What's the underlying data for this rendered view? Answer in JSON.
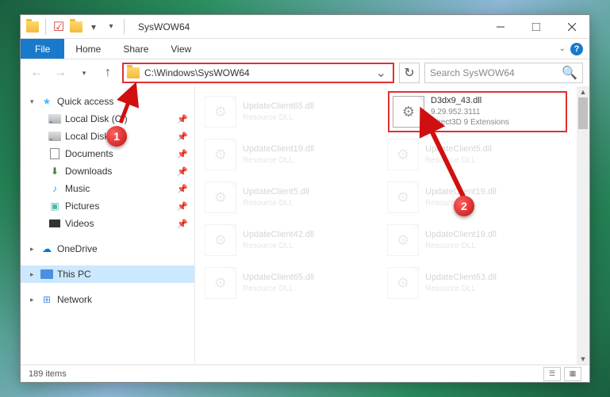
{
  "window": {
    "title": "SysWOW64"
  },
  "ribbon": {
    "file": "File",
    "tabs": [
      "Home",
      "Share",
      "View"
    ]
  },
  "nav": {
    "path": "C:\\Windows\\SysWOW64",
    "search_placeholder": "Search SysWOW64"
  },
  "sidebar": {
    "quick_access": "Quick access",
    "items": [
      {
        "label": "Local Disk (C:)",
        "icon": "disk"
      },
      {
        "label": "Local Disk (D:)",
        "icon": "disk"
      },
      {
        "label": "Documents",
        "icon": "doc"
      },
      {
        "label": "Downloads",
        "icon": "dl"
      },
      {
        "label": "Music",
        "icon": "music"
      },
      {
        "label": "Pictures",
        "icon": "pic"
      },
      {
        "label": "Videos",
        "icon": "vid"
      }
    ],
    "onedrive": "OneDrive",
    "thispc": "This PC",
    "network": "Network"
  },
  "highlight": {
    "name": "D3dx9_43.dll",
    "version": "9.29.952.3111",
    "desc": "Direct3D 9 Extensions"
  },
  "files": [
    {
      "name": "UpdateClient65.dll",
      "desc": "Resource DLL"
    },
    {
      "name": "UpdateClient19.dll",
      "desc": "Resource DLL"
    },
    {
      "name": "UpdateClient5.dll",
      "desc": "Resource DLL"
    },
    {
      "name": "UpdateClient5.dll",
      "desc": "Resource DLL"
    },
    {
      "name": "UpdateClient19.dll",
      "desc": "Resource DLL"
    },
    {
      "name": "UpdateClient42.dll",
      "desc": "Resource DLL"
    },
    {
      "name": "UpdateClient19.dll",
      "desc": "Resource DLL"
    },
    {
      "name": "UpdateClient65.dll",
      "desc": "Resource DLL"
    },
    {
      "name": "UpdateClient63.dll",
      "desc": "Resource DLL"
    }
  ],
  "status": {
    "items": "189 items"
  },
  "callouts": {
    "one": "1",
    "two": "2"
  }
}
